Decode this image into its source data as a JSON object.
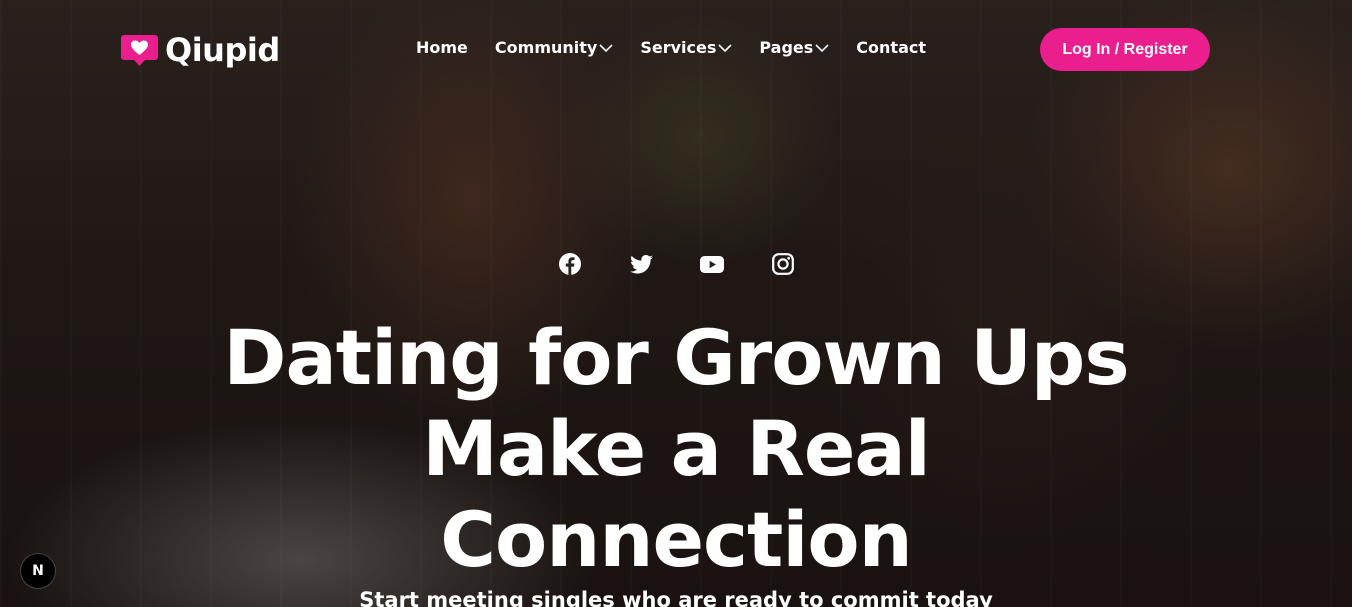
{
  "brand": {
    "name": "Qiupid",
    "accent": "#ea1e8d"
  },
  "nav": {
    "items": [
      {
        "label": "Home",
        "dropdown": false
      },
      {
        "label": "Community",
        "dropdown": true
      },
      {
        "label": "Services",
        "dropdown": true
      },
      {
        "label": "Pages",
        "dropdown": true
      },
      {
        "label": "Contact",
        "dropdown": false
      }
    ],
    "login_label": "Log In / Register"
  },
  "socials": [
    "facebook-icon",
    "twitter-icon",
    "youtube-icon",
    "instagram-icon"
  ],
  "hero": {
    "headline_lines": [
      "Dating for Grown Ups",
      "Make a Real",
      "Connection"
    ],
    "subline": "Start meeting singles who are ready to commit today"
  },
  "badge": {
    "label": "N"
  }
}
